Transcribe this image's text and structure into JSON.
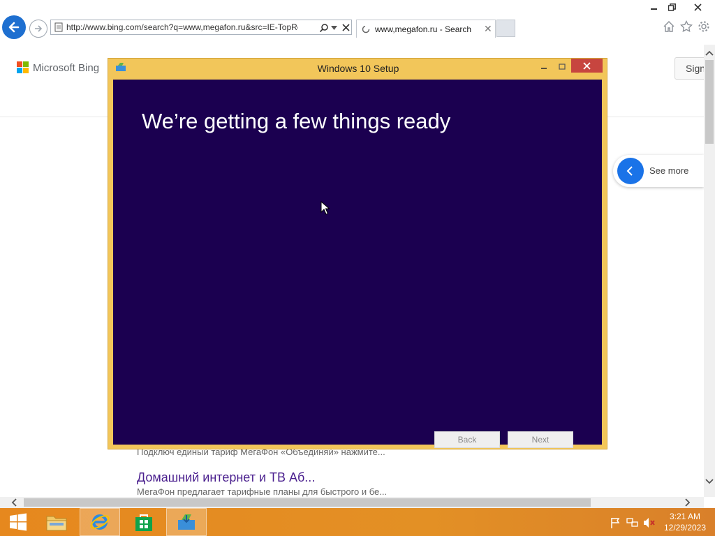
{
  "browser": {
    "address_url": "http://www.bing.com/search?q=www,megafon.ru&src=IE-TopResu",
    "tab_title": "www,megafon.ru - Search"
  },
  "bing": {
    "logo_text": "Microsoft Bing",
    "sign_in_label": "Sign",
    "see_more_label": "See more",
    "result_cut_text": "Подключ единый тариф МегаФон «Объединяй» нажмите...",
    "result_title": "Домашний интернет и ТВ Аб...",
    "result_snippet": "МегаФон предлагает тарифные планы для быстрого и бе..."
  },
  "setup_dialog": {
    "title": "Windows 10 Setup",
    "heading": "We’re getting a few things ready",
    "back_label": "Back",
    "next_label": "Next"
  },
  "taskbar": {
    "time": "3:21 AM",
    "date": "12/29/2023"
  },
  "colors": {
    "accent_blue": "#1e6fd0",
    "dialog_frame": "#f2c65a",
    "dialog_bg": "#1b0050",
    "taskbar": "#e6881e"
  }
}
